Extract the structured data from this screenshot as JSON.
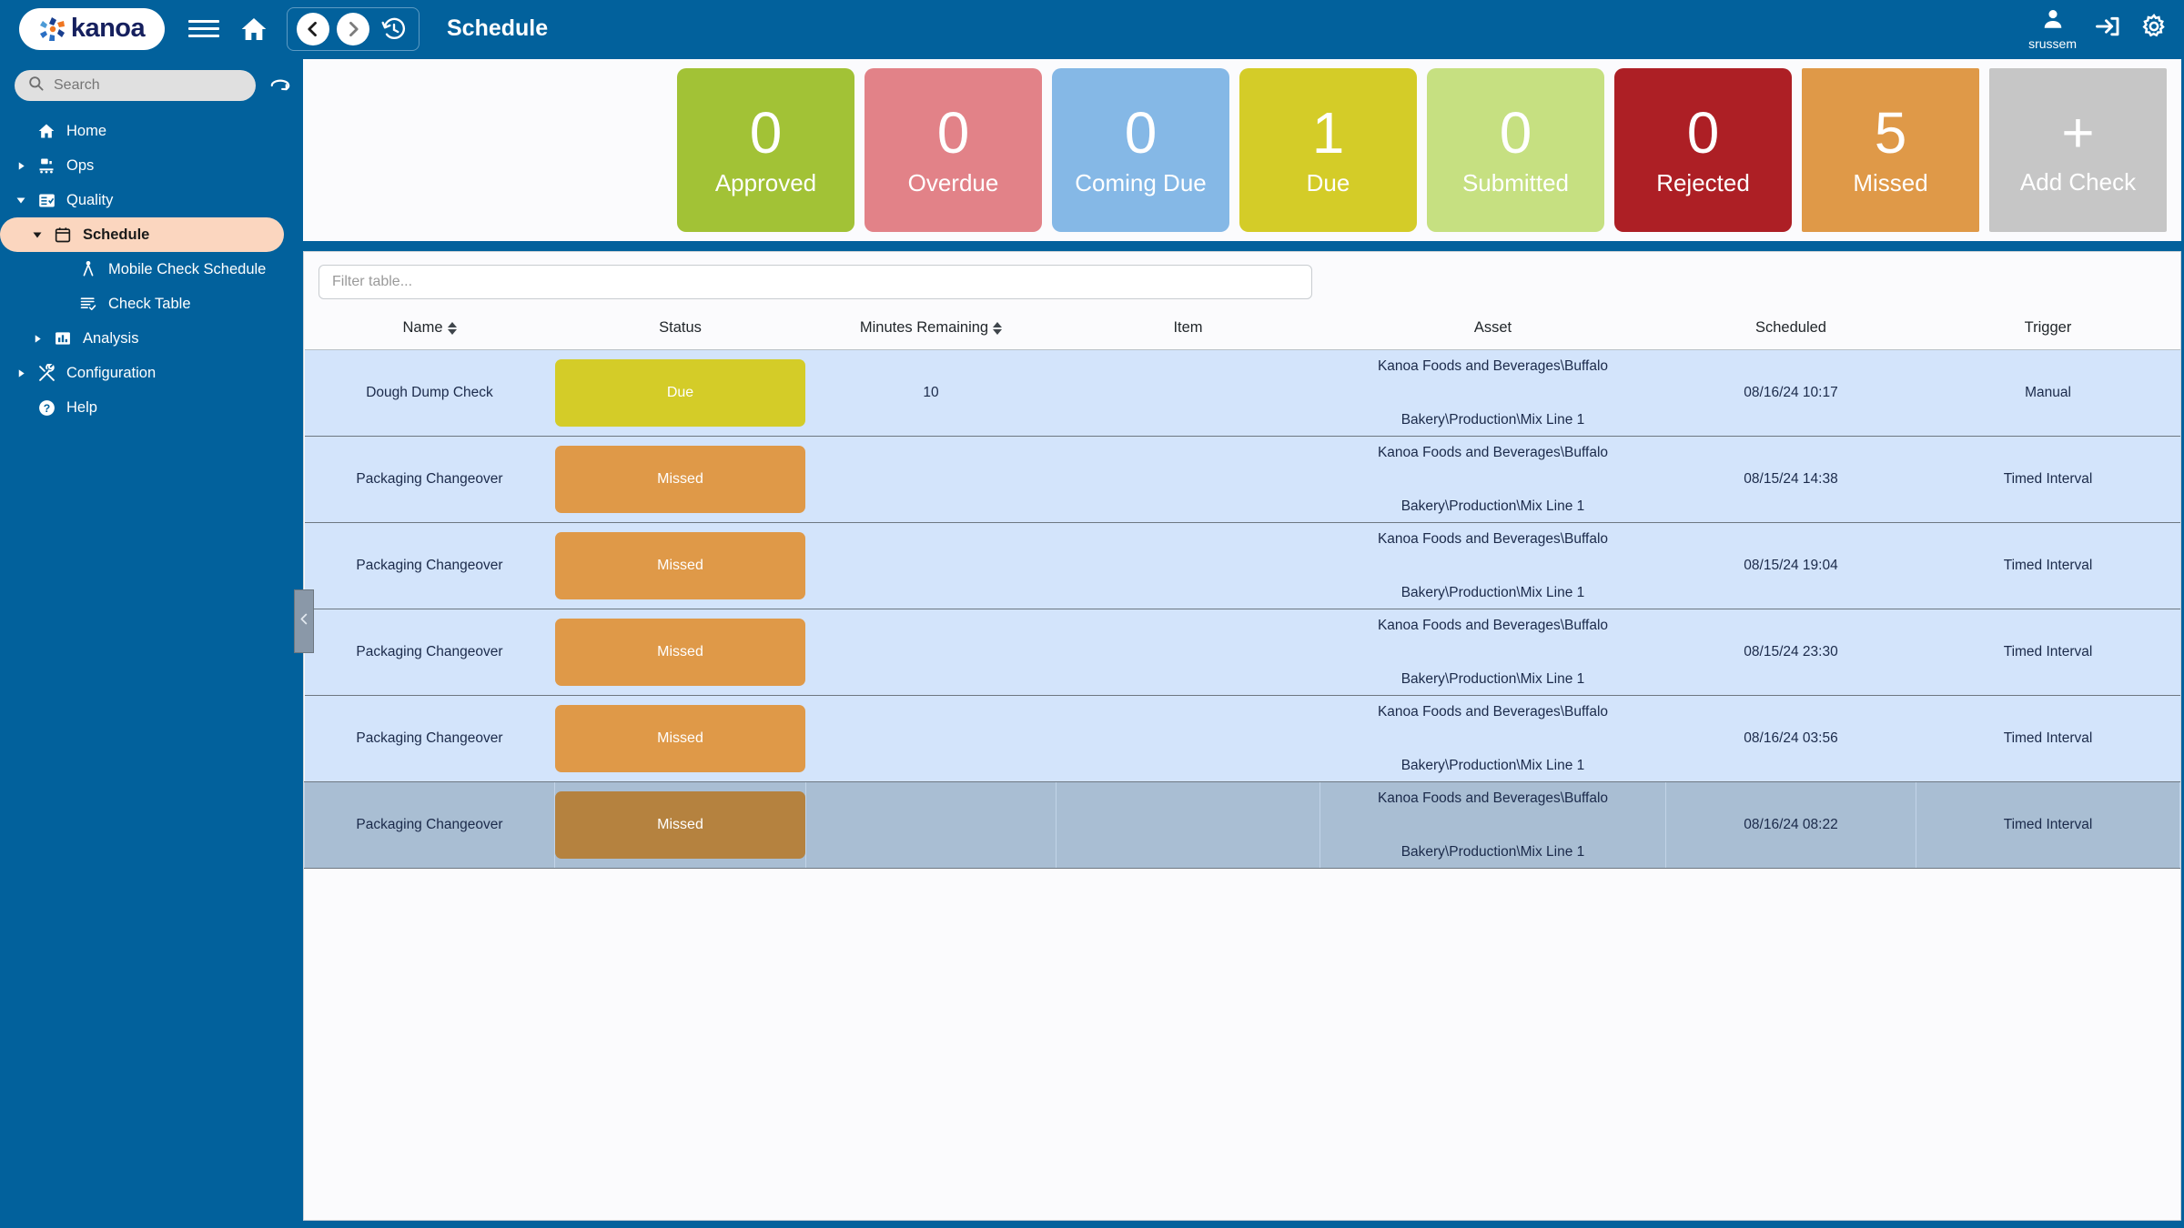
{
  "brand": {
    "name": "kanoa"
  },
  "topbar": {
    "page_title": "Schedule",
    "menu_icon": "hamburger-icon",
    "home_icon": "home-icon",
    "back_icon": "chevron-left-icon",
    "forward_icon": "chevron-right-icon",
    "history_icon": "history-clock-icon",
    "user_name": "srussem",
    "user_icon": "user-avatar-icon",
    "logout_icon": "sign-in-arrow-icon",
    "settings_icon": "gear-icon"
  },
  "sidebar": {
    "search_placeholder": "Search",
    "search_icon": "magnifier-icon",
    "scan_icon": "scan-rotate-icon",
    "items": [
      {
        "label": "Home",
        "level": 0,
        "icon": "home-icon",
        "caret": "none",
        "selected": false
      },
      {
        "label": "Ops",
        "level": 0,
        "icon": "factory-icon",
        "caret": "right",
        "selected": false
      },
      {
        "label": "Quality",
        "level": 0,
        "icon": "checklist-icon",
        "caret": "down",
        "selected": false
      },
      {
        "label": "Schedule",
        "level": 1,
        "icon": "calendar-icon",
        "caret": "down",
        "selected": true
      },
      {
        "label": "Mobile Check Schedule",
        "level": 2,
        "icon": "compass-icon",
        "caret": "none",
        "selected": false
      },
      {
        "label": "Check Table",
        "level": 2,
        "icon": "list-check-icon",
        "caret": "none",
        "selected": false
      },
      {
        "label": "Analysis",
        "level": 1,
        "icon": "bar-chart-icon",
        "caret": "right",
        "selected": false
      },
      {
        "label": "Configuration",
        "level": 0,
        "icon": "tools-icon",
        "caret": "right",
        "selected": false
      },
      {
        "label": "Help",
        "level": 0,
        "icon": "question-icon",
        "caret": "none",
        "selected": false
      }
    ]
  },
  "kpis": [
    {
      "value": "0",
      "label": "Approved",
      "color": "#a2c236",
      "square": false
    },
    {
      "value": "0",
      "label": "Overdue",
      "color": "#e28288",
      "square": false
    },
    {
      "value": "0",
      "label": "Coming Due",
      "color": "#85b8e6",
      "square": false
    },
    {
      "value": "1",
      "label": "Due",
      "color": "#d4cc28",
      "square": false
    },
    {
      "value": "0",
      "label": "Submitted",
      "color": "#c6e081",
      "square": false
    },
    {
      "value": "0",
      "label": "Rejected",
      "color": "#ad1f25",
      "square": false
    },
    {
      "value": "5",
      "label": "Missed",
      "color": "#df9948",
      "square": true
    },
    {
      "value": "+",
      "label": "Add Check",
      "color": "#c6c6c6",
      "square": true
    }
  ],
  "table": {
    "filter_placeholder": "Filter table...",
    "columns": [
      {
        "label": "Name",
        "sortable": true
      },
      {
        "label": "Status",
        "sortable": false
      },
      {
        "label": "Minutes Remaining",
        "sortable": true
      },
      {
        "label": "Item",
        "sortable": false
      },
      {
        "label": "Asset",
        "sortable": false
      },
      {
        "label": "Scheduled",
        "sortable": false
      },
      {
        "label": "Trigger",
        "sortable": false
      }
    ],
    "rows": [
      {
        "name": "Dough Dump Check",
        "status": "Due",
        "status_color": "#d4cc28",
        "minutes": "10",
        "item": "",
        "asset_line1": "Kanoa Foods and Beverages\\Buffalo",
        "asset_line2": "Bakery\\Production\\Mix Line 1",
        "scheduled": "08/16/24 10:17",
        "trigger": "Manual",
        "active": false
      },
      {
        "name": "Packaging Changeover",
        "status": "Missed",
        "status_color": "#df9948",
        "minutes": "",
        "item": "",
        "asset_line1": "Kanoa Foods and Beverages\\Buffalo",
        "asset_line2": "Bakery\\Production\\Mix Line 1",
        "scheduled": "08/15/24 14:38",
        "trigger": "Timed Interval",
        "active": false
      },
      {
        "name": "Packaging Changeover",
        "status": "Missed",
        "status_color": "#df9948",
        "minutes": "",
        "item": "",
        "asset_line1": "Kanoa Foods and Beverages\\Buffalo",
        "asset_line2": "Bakery\\Production\\Mix Line 1",
        "scheduled": "08/15/24 19:04",
        "trigger": "Timed Interval",
        "active": false
      },
      {
        "name": "Packaging Changeover",
        "status": "Missed",
        "status_color": "#df9948",
        "minutes": "",
        "item": "",
        "asset_line1": "Kanoa Foods and Beverages\\Buffalo",
        "asset_line2": "Bakery\\Production\\Mix Line 1",
        "scheduled": "08/15/24 23:30",
        "trigger": "Timed Interval",
        "active": false
      },
      {
        "name": "Packaging Changeover",
        "status": "Missed",
        "status_color": "#df9948",
        "minutes": "",
        "item": "",
        "asset_line1": "Kanoa Foods and Beverages\\Buffalo",
        "asset_line2": "Bakery\\Production\\Mix Line 1",
        "scheduled": "08/16/24 03:56",
        "trigger": "Timed Interval",
        "active": false
      },
      {
        "name": "Packaging Changeover",
        "status": "Missed",
        "status_color": "#b5823f",
        "minutes": "",
        "item": "",
        "asset_line1": "Kanoa Foods and Beverages\\Buffalo",
        "asset_line2": "Bakery\\Production\\Mix Line 1",
        "scheduled": "08/16/24 08:22",
        "trigger": "Timed Interval",
        "active": true
      }
    ]
  },
  "collapse_handle": {
    "icon": "chevron-left-icon"
  },
  "colors": {
    "brand_blue": "#02619c",
    "panel_bg": "#fbfbfd",
    "row_bg": "#d3e4fb",
    "row_active_bg": "#a9bed3",
    "selected_nav": "#fbd6bf"
  }
}
